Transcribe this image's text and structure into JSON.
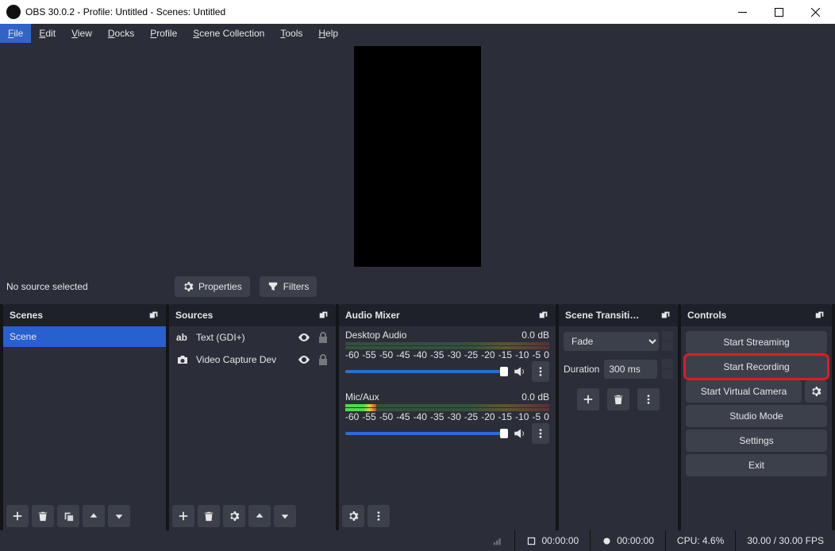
{
  "window": {
    "title": "OBS 30.0.2 - Profile: Untitled - Scenes: Untitled"
  },
  "menu": [
    "File",
    "Edit",
    "View",
    "Docks",
    "Profile",
    "Scene Collection",
    "Tools",
    "Help"
  ],
  "toolbar": {
    "info": "No source selected",
    "properties": "Properties",
    "filters": "Filters"
  },
  "panels": {
    "scenes": {
      "title": "Scenes",
      "items": [
        "Scene"
      ]
    },
    "sources": {
      "title": "Sources",
      "items": [
        {
          "icon": "text",
          "label": "Text (GDI+)"
        },
        {
          "icon": "camera",
          "label": "Video Capture Dev"
        }
      ]
    },
    "mixer": {
      "title": "Audio Mixer",
      "channels": [
        {
          "name": "Desktop Audio",
          "db": "0.0 dB"
        },
        {
          "name": "Mic/Aux",
          "db": "0.0 dB"
        }
      ],
      "ticks": [
        "-60",
        "-55",
        "-50",
        "-45",
        "-40",
        "-35",
        "-30",
        "-25",
        "-20",
        "-15",
        "-10",
        "-5",
        "0"
      ]
    },
    "trans": {
      "title": "Scene Transiti…",
      "selected": "Fade",
      "duration_lbl": "Duration",
      "duration": "300 ms"
    },
    "controls": {
      "title": "Controls",
      "buttons": {
        "stream": "Start Streaming",
        "record": "Start Recording",
        "vcam": "Start Virtual Camera",
        "studio": "Studio Mode",
        "settings": "Settings",
        "exit": "Exit"
      }
    }
  },
  "status": {
    "live_time": "00:00:00",
    "rec_time": "00:00:00",
    "cpu": "CPU: 4.6%",
    "fps": "30.00 / 30.00 FPS"
  }
}
